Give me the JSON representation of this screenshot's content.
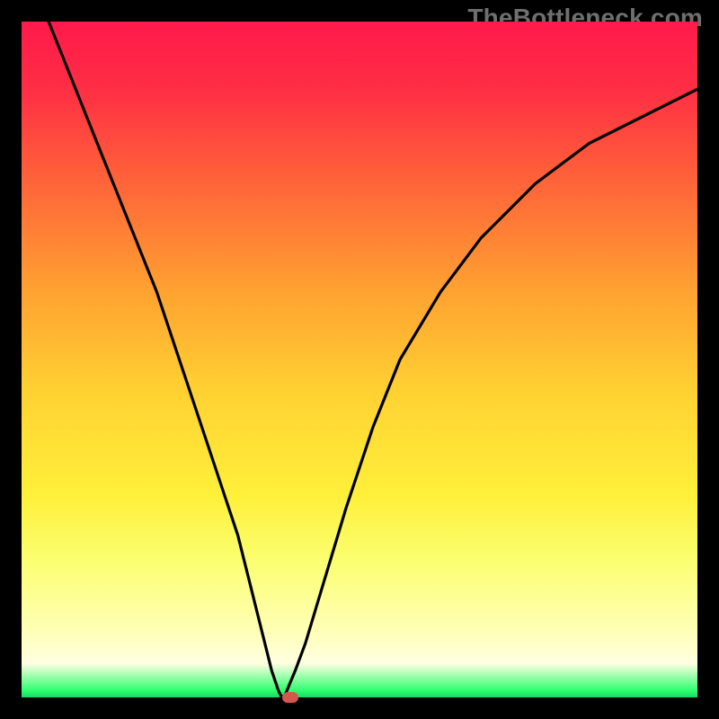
{
  "watermark": "TheBottleneck.com",
  "chart_data": {
    "type": "line",
    "title": "",
    "xlabel": "",
    "ylabel": "",
    "xlim": [
      0,
      100
    ],
    "ylim": [
      0,
      100
    ],
    "grid": false,
    "legend": false,
    "series": [
      {
        "name": "curve",
        "x": [
          4,
          8,
          12,
          16,
          20,
          24,
          28,
          32,
          34,
          36,
          37,
          38,
          38.5,
          39,
          40.5,
          42,
          45,
          48,
          52,
          56,
          62,
          68,
          76,
          84,
          92,
          100
        ],
        "y": [
          100,
          90,
          80,
          70,
          60,
          48,
          36,
          24,
          16,
          8,
          4,
          1,
          0,
          0.4,
          4,
          8,
          18,
          28,
          40,
          50,
          60,
          68,
          76,
          82,
          86,
          90
        ]
      }
    ],
    "marker": {
      "x": 39.8,
      "y": 0
    },
    "colors": {
      "gradient_top": "#ff1a4b",
      "gradient_mid": "#ffd232",
      "gradient_bottom": "#18d964",
      "curve": "#000000",
      "marker": "#d4574f",
      "frame": "#000000"
    }
  }
}
